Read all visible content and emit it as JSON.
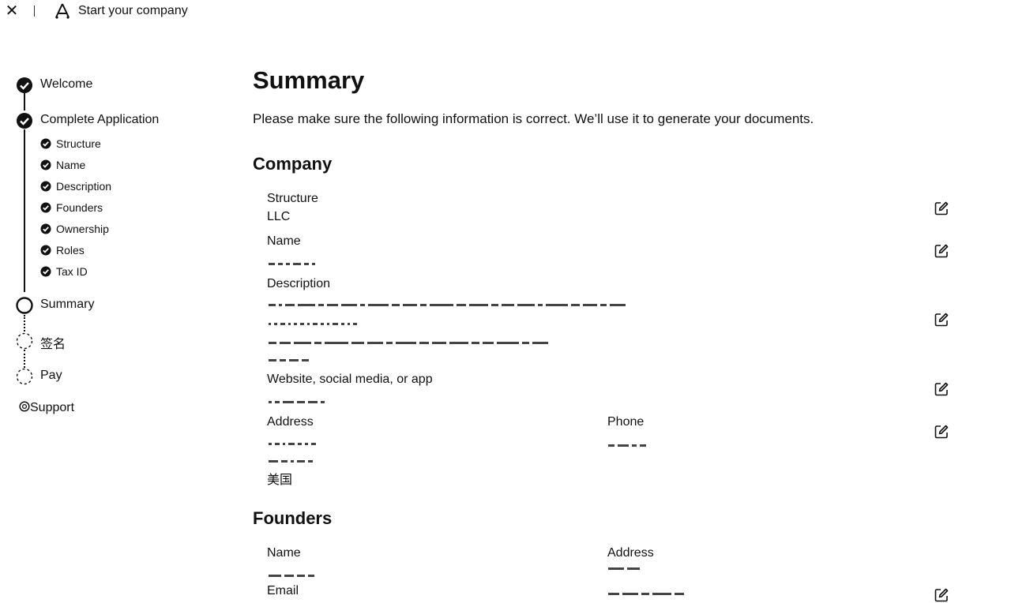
{
  "topbar": {
    "close_icon": "close-icon",
    "logo_icon": "logo-icon",
    "title": "Start your company"
  },
  "stepper": {
    "steps": [
      {
        "label": "Welcome",
        "state": "done"
      },
      {
        "label": "Complete Application",
        "state": "done",
        "substeps": [
          "Structure",
          "Name",
          "Description",
          "Founders",
          "Ownership",
          "Roles",
          "Tax ID"
        ]
      },
      {
        "label": "Summary",
        "state": "current"
      },
      {
        "label": "签名",
        "state": "pending"
      },
      {
        "label": "Pay",
        "state": "pending"
      }
    ],
    "support_label": "Support",
    "support_icon": "support-icon"
  },
  "main": {
    "title": "Summary",
    "intro": "Please make sure the following information is correct. We’ll use it to generate your documents.",
    "company": {
      "heading": "Company",
      "structure_label": "Structure",
      "structure_value": "LLC",
      "name_label": "Name",
      "description_label": "Description",
      "website_label": "Website, social media, or app",
      "address_label": "Address",
      "address_country": "美国",
      "phone_label": "Phone"
    },
    "founders": {
      "heading": "Founders",
      "name_label": "Name",
      "address_label": "Address",
      "email_label": "Email"
    }
  },
  "colors": {
    "text": "#111111",
    "background": "#ffffff"
  }
}
